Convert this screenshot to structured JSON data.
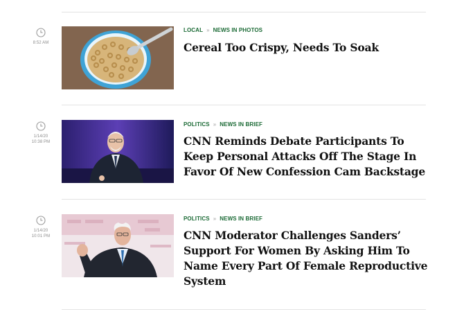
{
  "articles": [
    {
      "time": "8:52 AM",
      "date": "",
      "section": "LOCAL",
      "subsection": "NEWS IN PHOTOS",
      "headline": "Cereal Too Crispy, Needs To Soak",
      "image": "bowl-of-cereal"
    },
    {
      "time": "10:38 PM",
      "date": "1/14/20",
      "section": "POLITICS",
      "subsection": "NEWS IN BRIEF",
      "headline": "CNN Reminds Debate Participants To Keep Personal Attacks Off The Stage In Favor Of New Confession Cam Backstage",
      "image": "man-in-suit-on-stage"
    },
    {
      "time": "10:01 PM",
      "date": "1/14/20",
      "section": "POLITICS",
      "subsection": "NEWS IN BRIEF",
      "headline": "CNN Moderator Challenges Sanders’ Support For Women By Asking Him To Name Every Part Of Female Reproductive System",
      "image": "man-gesturing-at-debate"
    }
  ],
  "icons": {
    "time": "clock-icon",
    "separator": "chevron-right-icon"
  },
  "colors": {
    "section_link": "#1b6a35",
    "headline": "#111111",
    "timestamp": "#8b8b8b"
  }
}
